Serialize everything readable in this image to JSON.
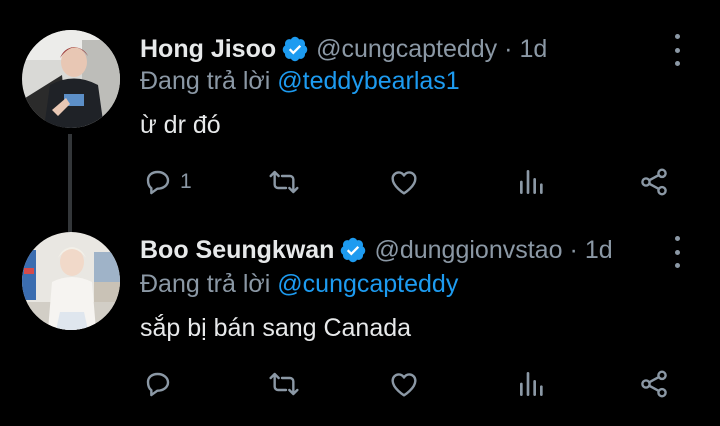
{
  "tweets": [
    {
      "name": "Hong Jisoo",
      "verified": true,
      "handle": "@cungcapteddy",
      "separator": "·",
      "time": "1d",
      "replying_prefix": "Đang trả lời ",
      "replying_to": "@teddybearlas1",
      "text": "ừ dr đó",
      "reply_count": "1"
    },
    {
      "name": "Boo Seungkwan",
      "verified": true,
      "handle": "@dunggionvstao",
      "separator": "·",
      "time": "1d",
      "replying_prefix": "Đang trả lời ",
      "replying_to": "@cungcapteddy",
      "text": "sắp bị bán sang Canada",
      "reply_count": ""
    }
  ],
  "icons": {
    "verified": "verified-badge-icon",
    "more": "more-vertical-icon",
    "reply": "reply-icon",
    "retweet": "retweet-icon",
    "like": "heart-icon",
    "views": "views-icon",
    "share": "share-icon"
  },
  "colors": {
    "background": "#000000",
    "primary_text": "#e7e9ea",
    "secondary_text": "#8b98a5",
    "accent": "#1d9bf0",
    "thread_line": "#333639"
  }
}
